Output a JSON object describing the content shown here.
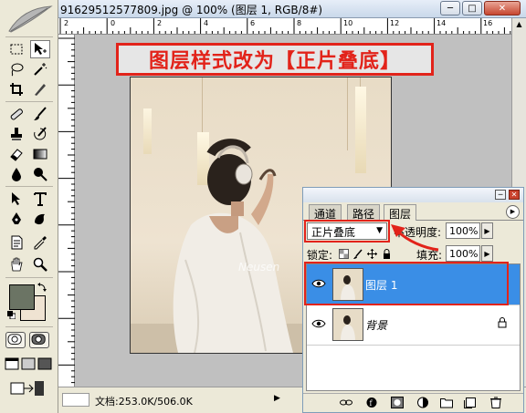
{
  "document": {
    "title": "91629512577809.jpg @ 100% (图层 1, RGB/8#)",
    "ruler_ticks": [
      "2",
      "0",
      "2",
      "4",
      "6",
      "8",
      "10",
      "12",
      "14",
      "16"
    ],
    "status": "文档:253.0K/506.0K",
    "status_arrow": "▶"
  },
  "window_controls": {
    "minimize": "─",
    "maximize": "□",
    "close": "✕"
  },
  "annotation": {
    "text": "图层样式改为【正片叠底】",
    "color": "#e2231a"
  },
  "colors": {
    "foreground": "#6b7464",
    "background": "#efe3d2",
    "selection": "#3a8ee6"
  },
  "toolbox": {
    "tools": [
      "marquee-icon",
      "move-icon",
      "lasso-icon",
      "magic-wand-icon",
      "crop-icon",
      "slice-icon",
      "healing-brush-icon",
      "brush-icon",
      "clone-stamp-icon",
      "history-brush-icon",
      "eraser-icon",
      "gradient-icon",
      "blur-icon",
      "dodge-icon",
      "path-selection-icon",
      "type-icon",
      "pen-icon",
      "custom-shape-icon",
      "notes-icon",
      "eyedropper-icon",
      "hand-icon",
      "zoom-icon"
    ]
  },
  "layers_panel": {
    "tabs": [
      "通道",
      "路径",
      "图层"
    ],
    "active_tab": "图层",
    "blend_mode": "正片叠底",
    "opacity_label": "不透明度:",
    "opacity_value": "100%",
    "lock_label": "锁定:",
    "fill_label": "填充:",
    "fill_value": "100%",
    "layers": [
      {
        "name": "图层 1",
        "selected": true
      },
      {
        "name": "背景",
        "selected": false,
        "locked": true
      }
    ]
  }
}
